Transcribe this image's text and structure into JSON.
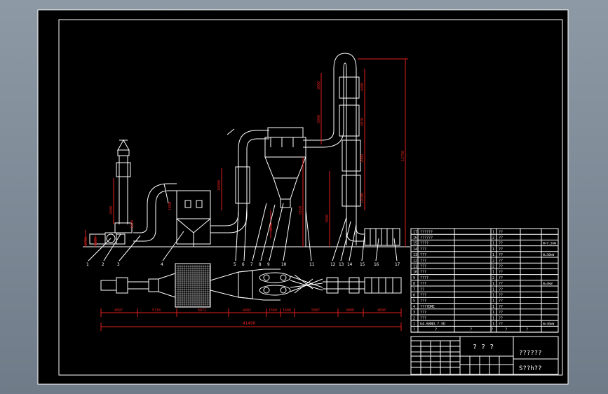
{
  "colors": {
    "sheet": "#000000",
    "line": "#ffffff",
    "dim": "#e0201c",
    "viewport": "#7b8794"
  },
  "callouts": [
    "1",
    "2",
    "3",
    "4",
    "5",
    "6",
    "7",
    "8",
    "9",
    "10",
    "11",
    "12",
    "13",
    "14",
    "15",
    "16",
    "17"
  ],
  "dims": {
    "total": "41490",
    "segs": [
      "4097",
      "5718",
      "6472",
      "4402",
      "1560",
      "1680",
      "5087",
      "3000",
      "4890"
    ],
    "small": [
      "2700",
      "2285",
      "2800",
      "1890",
      "1890",
      "10900",
      "8160",
      "3250",
      "7600",
      "14500",
      "3000",
      "5000",
      "4490",
      "2070",
      "2000",
      "12750"
    ]
  },
  "bom": {
    "rows": [
      {
        "no": "17",
        "name": "??????",
        "qty": "1",
        "mat": "??"
      },
      {
        "no": "16",
        "name": "??????",
        "qty": "2",
        "mat": "??"
      },
      {
        "no": "15",
        "name": "????",
        "qty": "1",
        "mat": "??"
      },
      {
        "no": "14",
        "name": "???",
        "qty": "1",
        "mat": "??"
      },
      {
        "no": "13",
        "name": "???",
        "qty": "1",
        "mat": "??"
      },
      {
        "no": "12",
        "name": "???",
        "qty": "2",
        "mat": "??"
      },
      {
        "no": "11",
        "name": "???",
        "qty": "2",
        "mat": "??"
      },
      {
        "no": "10",
        "name": "???",
        "qty": "1",
        "mat": "??"
      },
      {
        "no": "9",
        "name": "????",
        "qty": "2",
        "mat": "??"
      },
      {
        "no": "8",
        "name": "???",
        "qty": "1",
        "mat": "??"
      },
      {
        "no": "7",
        "name": "??",
        "qty": "1",
        "mat": "??"
      },
      {
        "no": "6",
        "name": "???",
        "qty": "1",
        "mat": "??"
      },
      {
        "no": "5",
        "name": "???",
        "qty": "1",
        "mat": "??"
      },
      {
        "no": "4",
        "name": "????DMC",
        "qty": "1",
        "mat": "??"
      },
      {
        "no": "3",
        "name": "???",
        "qty": "1",
        "mat": "??"
      },
      {
        "no": "2",
        "name": "???",
        "qty": "1",
        "mat": "??"
      },
      {
        "no": "1",
        "name": "G4-68NO.7.5D",
        "qty": "1",
        "mat": "??"
      }
    ],
    "notes": [
      "N=7.5kW",
      "N=30kW",
      "N=4kW",
      "N=30kW"
    ],
    "header": [
      "?",
      "?",
      "?",
      "?",
      "?",
      "?"
    ]
  },
  "title_block": {
    "main": "? ? ?",
    "sub1": "??????",
    "sub2": "S??h??"
  }
}
